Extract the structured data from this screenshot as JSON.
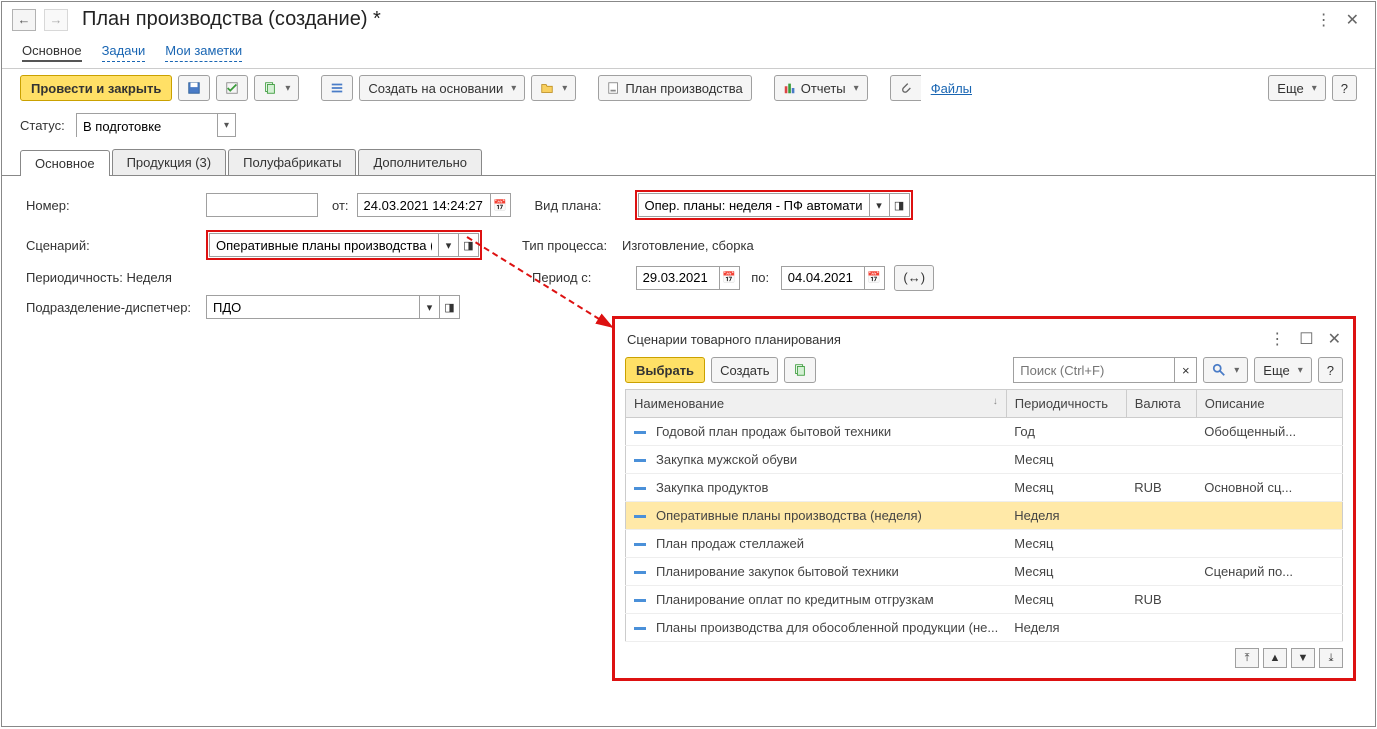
{
  "title": "План производства (создание) *",
  "linkbar": {
    "main": "Основное",
    "tasks": "Задачи",
    "notes": "Мои заметки"
  },
  "toolbar": {
    "post_close": "Провести и закрыть",
    "create_based": "Создать на основании",
    "plan_prod": "План производства",
    "reports": "Отчеты",
    "files": "Файлы",
    "more": "Еще",
    "help": "?"
  },
  "status_label": "Статус:",
  "status_value": "В подготовке",
  "tabs": {
    "main": "Основное",
    "products": "Продукция (3)",
    "semi": "Полуфабрикаты",
    "extra": "Дополнительно"
  },
  "form": {
    "number_label": "Номер:",
    "from_label": "от:",
    "date": "24.03.2021 14:24:27",
    "scenario_label": "Сценарий:",
    "scenario_value": "Оперативные планы производства (не",
    "periodicity_label": "Периодичность:",
    "periodicity_value": "Неделя",
    "dept_label": "Подразделение-диспетчер:",
    "dept_value": "ПДО",
    "plan_type_label": "Вид плана:",
    "plan_type_value": "Опер. планы: неделя - ПФ автоматиче",
    "process_label": "Тип процесса:",
    "process_value": "Изготовление, сборка",
    "period_label": "Период с:",
    "period_from": "29.03.2021",
    "period_to_label": "по:",
    "period_to": "04.04.2021"
  },
  "popup": {
    "title": "Сценарии товарного планирования",
    "choose": "Выбрать",
    "create": "Создать",
    "search_ph": "Поиск (Ctrl+F)",
    "more": "Еще",
    "help": "?",
    "cols": {
      "name": "Наименование",
      "period": "Периодичность",
      "currency": "Валюта",
      "desc": "Описание"
    },
    "rows": [
      {
        "name": "Годовой план продаж бытовой техники",
        "period": "Год",
        "currency": "",
        "desc": "Обобщенный..."
      },
      {
        "name": "Закупка мужской обуви",
        "period": "Месяц",
        "currency": "",
        "desc": ""
      },
      {
        "name": "Закупка продуктов",
        "period": "Месяц",
        "currency": "RUB",
        "desc": "Основной сц..."
      },
      {
        "name": "Оперативные планы производства (неделя)",
        "period": "Неделя",
        "currency": "",
        "desc": "",
        "selected": true
      },
      {
        "name": "План продаж стеллажей",
        "period": "Месяц",
        "currency": "",
        "desc": ""
      },
      {
        "name": "Планирование закупок бытовой техники",
        "period": "Месяц",
        "currency": "",
        "desc": "Сценарий по..."
      },
      {
        "name": "Планирование оплат по кредитным отгрузкам",
        "period": "Месяц",
        "currency": "RUB",
        "desc": ""
      },
      {
        "name": "Планы производства для обособленной продукции (не...",
        "period": "Неделя",
        "currency": "",
        "desc": ""
      }
    ]
  }
}
